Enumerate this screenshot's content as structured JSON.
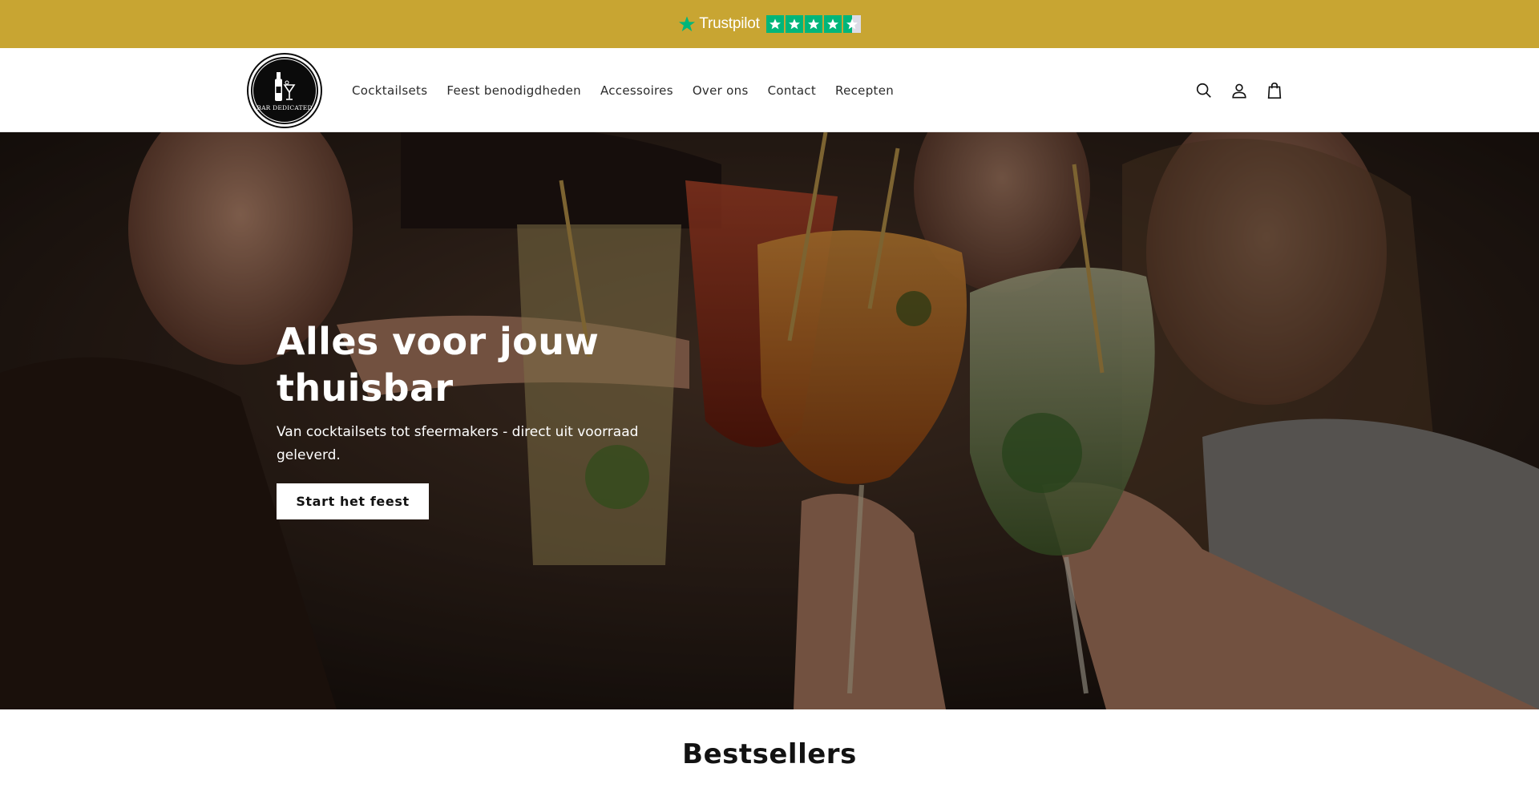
{
  "announcement": {
    "brand": "Trustpilot",
    "rating_stars": 4.5,
    "bg_color": "#c8a532",
    "star_color": "#00b67a"
  },
  "header": {
    "logo_text": "BAR DEDICATED",
    "nav": [
      {
        "label": "Cocktailsets"
      },
      {
        "label": "Feest benodigdheden"
      },
      {
        "label": "Accessoires"
      },
      {
        "label": "Over ons"
      },
      {
        "label": "Contact"
      },
      {
        "label": "Recepten"
      }
    ],
    "icons": [
      "search-icon",
      "account-icon",
      "cart-icon"
    ]
  },
  "hero": {
    "title": "Alles voor jouw thuisbar",
    "subtitle": "Van cocktailsets tot sfeermakers - direct uit voorraad geleverd.",
    "cta_label": "Start het feest"
  },
  "bestsellers": {
    "title": "Bestsellers"
  }
}
